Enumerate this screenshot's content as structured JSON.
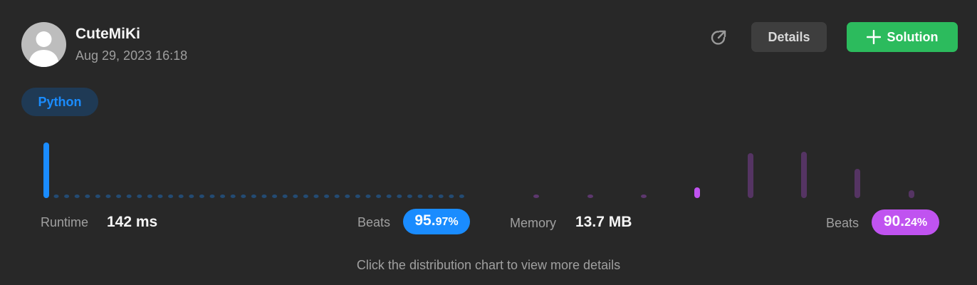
{
  "user": {
    "name": "CuteMiKi",
    "timestamp": "Aug 29, 2023 16:18"
  },
  "actions": {
    "details_label": "Details",
    "solution_label": "Solution"
  },
  "language": "Python",
  "runtime": {
    "label": "Runtime",
    "value": "142 ms",
    "beats_label": "Beats",
    "beats_main": "95.",
    "beats_decimal": "97%",
    "color": "#1a8cff",
    "active_fraction": 0.0403
  },
  "memory": {
    "label": "Memory",
    "value": "13.7 MB",
    "beats_label": "Beats",
    "beats_main": "90.",
    "beats_decimal": "24%",
    "color": "#c053f0",
    "active_fraction": 0.0976
  },
  "hint": "Click the distribution chart to view more details",
  "icons": [
    "avatar-icon",
    "share-icon",
    "plus-icon"
  ],
  "colors": {
    "accent_green": "#2cbb5d",
    "accent_blue": "#1a8cff",
    "accent_purple": "#c053f0",
    "background": "#282828"
  }
}
